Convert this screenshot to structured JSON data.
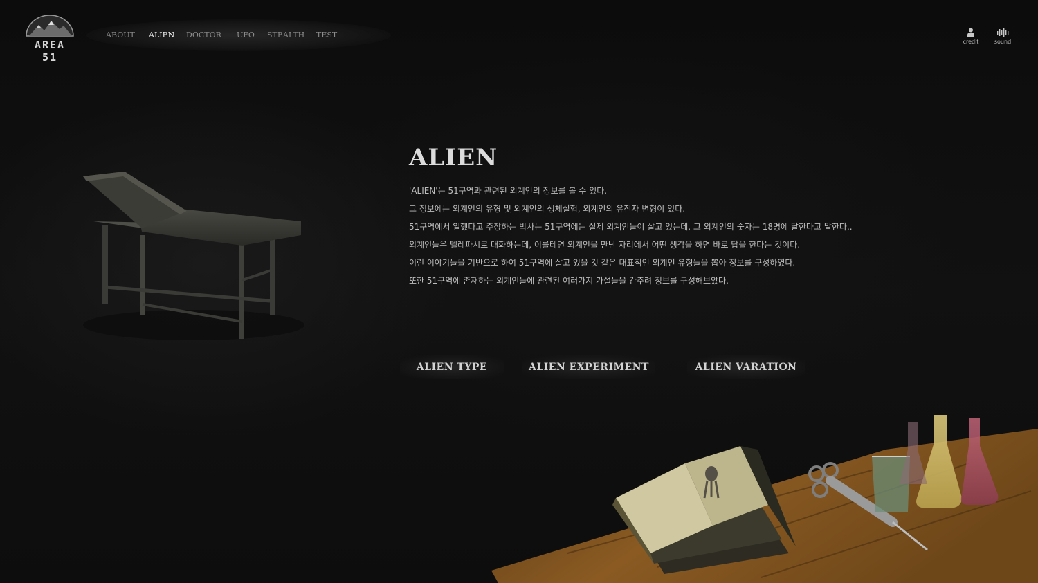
{
  "logo": {
    "text": "AREA 51"
  },
  "nav": {
    "items": [
      {
        "label": "ABOUT",
        "active": false
      },
      {
        "label": "ALIEN",
        "active": true
      },
      {
        "label": "DOCTOR",
        "active": false
      },
      {
        "label": "UFO",
        "active": false
      },
      {
        "label": "STEALTH",
        "active": false
      },
      {
        "label": "TEST",
        "active": false
      }
    ]
  },
  "utilities": {
    "credit_label": "credit",
    "sound_label": "sound"
  },
  "main": {
    "title": "ALIEN",
    "paragraphs": [
      "'ALIEN'는 51구역과 관련된 외계인의 정보를 볼 수 있다.",
      "그 정보에는 외계인의 유형 및 외계인의 생체실험, 외계인의 유전자 변형이 있다.",
      "51구역에서 일했다고 주장하는 박사는 51구역에는 실제 외계인들이 살고 있는데, 그 외계인의 숫자는 18명에 달한다고 말한다..",
      "외계인들은 텔레파시로 대화하는데, 이를테면 외계인을 만난 자리에서 어떤 생각을 하면 바로 답을 한다는 것이다.",
      "이런 이야기들을 기반으로 하여 51구역에 살고 있을 것 같은 대표적인 외계인 유형들을 뽑아 정보를 구성하였다.",
      "또한 51구역에 존재하는 외계인들에 관련된 여러가지 가설들을 간추려 정보를 구성해보았다."
    ],
    "buttons": {
      "type": "ALIEN TYPE",
      "experiment": "ALIEN EXPERIMENT",
      "variation": "ALIEN VARATION"
    }
  },
  "colors": {
    "background": "#0e0e0e",
    "text_primary": "#dcdcdc",
    "text_muted": "#8c8c8c",
    "wood": "#8a5a22"
  }
}
